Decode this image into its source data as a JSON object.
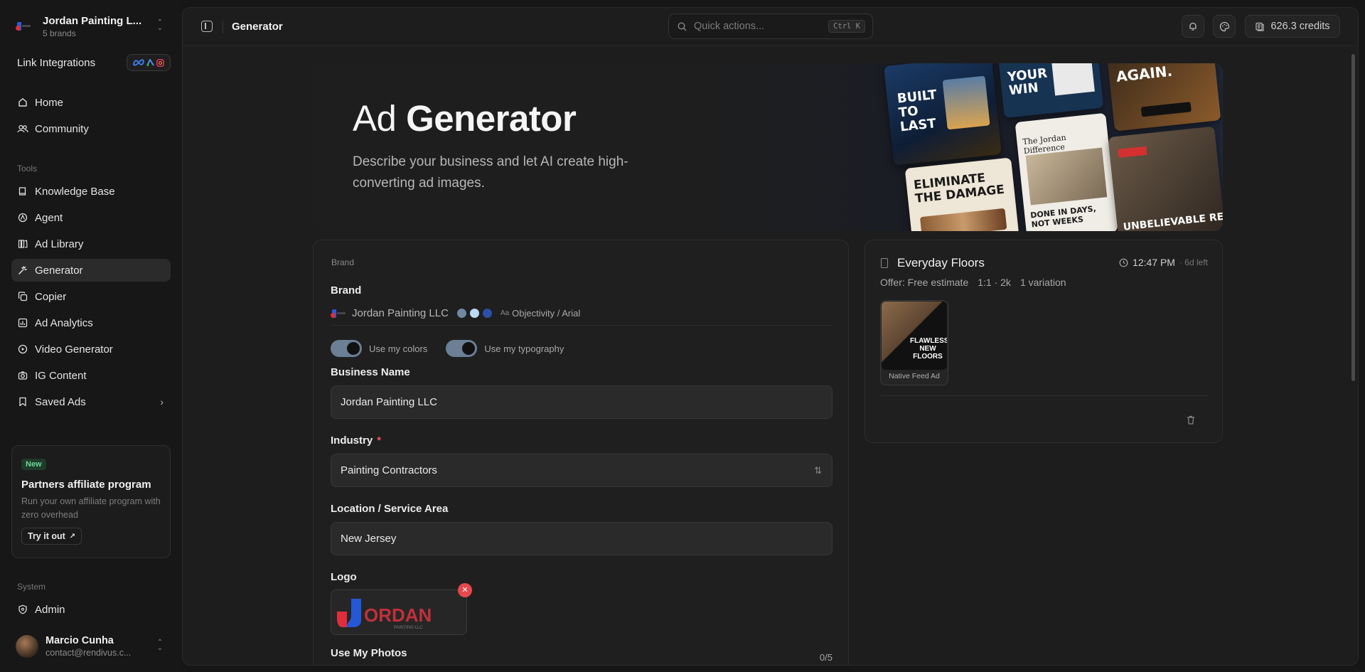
{
  "workspace": {
    "name": "Jordan Painting L...",
    "subtitle": "5 brands"
  },
  "link_integrations": {
    "label": "Link Integrations"
  },
  "nav_main": [
    {
      "label": "Home",
      "icon": "home-icon"
    },
    {
      "label": "Community",
      "icon": "users-icon"
    }
  ],
  "sections": {
    "tools": "Tools",
    "system": "System"
  },
  "nav_tools": [
    {
      "label": "Knowledge Base",
      "icon": "book-icon"
    },
    {
      "label": "Agent",
      "icon": "agent-icon"
    },
    {
      "label": "Ad Library",
      "icon": "library-icon"
    },
    {
      "label": "Generator",
      "icon": "sparkle-icon",
      "active": true
    },
    {
      "label": "Copier",
      "icon": "copy-icon"
    },
    {
      "label": "Ad Analytics",
      "icon": "chart-icon"
    },
    {
      "label": "Video Generator",
      "icon": "video-icon"
    },
    {
      "label": "IG Content",
      "icon": "camera-icon"
    },
    {
      "label": "Saved Ads",
      "icon": "bookmark-icon"
    }
  ],
  "promo": {
    "badge": "New",
    "title": "Partners affiliate program",
    "description": "Run your own affiliate program with zero overhead",
    "button": "Try it out"
  },
  "nav_system": [
    {
      "label": "Admin",
      "icon": "shield-icon"
    }
  ],
  "user": {
    "name": "Marcio Cunha",
    "email": "contact@rendivus.c..."
  },
  "topbar": {
    "page_title": "Generator",
    "search_placeholder": "Quick actions...",
    "shortcut": "Ctrl K",
    "credits": "626.3 credits"
  },
  "hero": {
    "title_light": "Ad",
    "title_bold": "Generator",
    "description": "Describe your business and let AI create high-converting ad images.",
    "collage_texts": [
      "BUILT TO LAST",
      "YOUR WIN",
      "AGAIN.",
      "ELIMINATE THE DAMAGE",
      "The Jordan Difference",
      "DONE IN DAYS, NOT WEEKS",
      "UNBELIEVABLE RESU"
    ]
  },
  "form": {
    "section": "Brand",
    "brand_label": "Brand",
    "brand_name": "Jordan Painting LLC",
    "brand_colors": [
      "#6f89a3",
      "#b9dcf2",
      "#2d4fa6"
    ],
    "typography_icon": "Aa",
    "typography": "Objectivity / Arial",
    "toggle_colors": "Use my colors",
    "toggle_typography": "Use my typography",
    "business_name_label": "Business Name",
    "business_name": "Jordan Painting LLC",
    "industry_label": "Industry",
    "industry_required": "*",
    "industry": "Painting Contractors",
    "location_label": "Location / Service Area",
    "location": "New Jersey",
    "logo_label": "Logo",
    "logo_text": "ORDAN",
    "logo_subtext": "PAINTING LLC",
    "photos_label": "Use My Photos",
    "photos_count": "0/5"
  },
  "result": {
    "title": "Everyday Floors",
    "time": "12:47 PM",
    "time_left": "· 6d left",
    "offer": "Offer: Free estimate",
    "specs": "1:1 · 2k",
    "variations": "1 variation",
    "thumb_text": "FLAWLESS NEW FLOORS",
    "thumb_caption": "Native Feed Ad"
  }
}
